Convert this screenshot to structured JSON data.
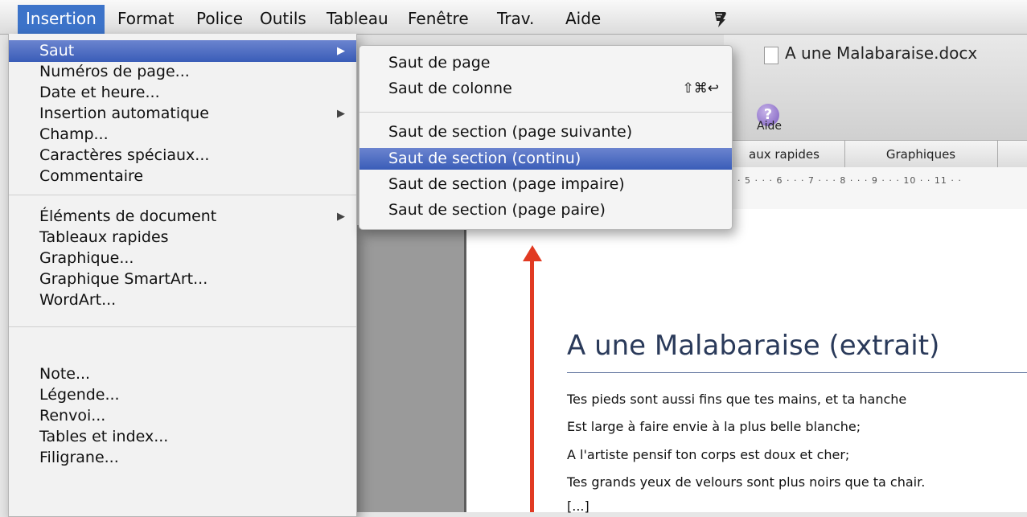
{
  "menubar": {
    "items": [
      "Insertion",
      "Format",
      "Police",
      "Outils",
      "Tableau",
      "Fenêtre",
      "Trav.",
      "Aide"
    ],
    "script_icon": "script-menu-icon"
  },
  "window": {
    "title": "A une Malabaraise.docx",
    "help_label": "Aide",
    "help_glyph": "?",
    "ribbon_tabs": [
      "aux rapides",
      "Graphiques"
    ],
    "ruler_text": "· · 5 · · · 6 · · · 7 · · · 8 · · · 9 · · · 10 · · 11 · ·"
  },
  "document": {
    "heading": "A une Malabaraise (extrait)",
    "lines": [
      "Tes pieds sont aussi fins que tes mains, et ta hanche",
      "Est large à faire envie à la plus belle blanche;",
      "A l'artiste pensif ton corps est doux et cher;",
      "Tes grands yeux de velours sont plus noirs que ta chair.",
      "[...]"
    ]
  },
  "menu": {
    "groups": [
      [
        "Saut",
        "Numéros de page...",
        "Date et heure...",
        "Insertion automatique",
        "Champ...",
        "Caractères spéciaux...",
        "Commentaire"
      ],
      [
        "Éléments de document",
        "Tableaux rapides",
        "Graphique...",
        "Graphique SmartArt...",
        "WordArt..."
      ],
      [
        "Note...",
        "Légende...",
        "Renvoi...",
        "Tables et index...",
        "Filigrane..."
      ]
    ],
    "highlighted": "Saut",
    "submenu_arrow": "▶"
  },
  "submenu": {
    "items": [
      "Saut de page",
      "Saut de colonne",
      "Saut de section (page suivante)",
      "Saut de section (continu)",
      "Saut de section (page impaire)",
      "Saut de section  (page paire)"
    ],
    "shortcut": "⇧⌘↩",
    "highlighted": "Saut de section (continu)"
  },
  "colors": {
    "highlight": "#3a5db8",
    "annotation_arrow": "#e13a22"
  }
}
